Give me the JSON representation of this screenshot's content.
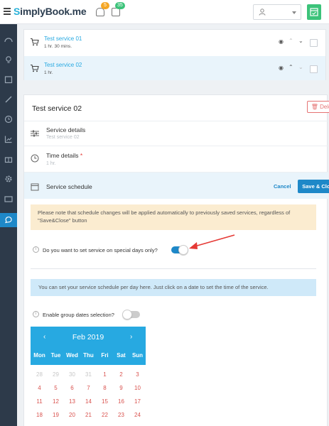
{
  "topbar": {
    "logo_prefix": "S",
    "logo_rest": "implyBook.me",
    "bell_badge": "5",
    "tasks_badge": "35",
    "badge_color_bell": "#f5a623",
    "badge_color_tasks": "#3cc37a"
  },
  "services": [
    {
      "name": "Test service 01",
      "duration": "1 hr. 30 mins."
    },
    {
      "name": "Test service 02",
      "duration": "1 hr."
    }
  ],
  "panel": {
    "title": "Test service 02",
    "delete_label": "Delete",
    "details_label": "Service details",
    "details_value": "Test service 02",
    "time_label": "Time details",
    "time_required": "*",
    "time_value": "1 hr.",
    "schedule_label": "Service schedule",
    "cancel_label": "Cancel",
    "save_label": "Save & Close",
    "warning_text": "Please note that schedule changes will be applied automatically to previously saved services, regardless of \"Save&Close\" button",
    "special_days_question": "Do you want to set service on special days only?",
    "special_days_on": true,
    "info_text": "You can set your service schedule per day here. Just click on a date to set the time of the service.",
    "group_dates_label": "Enable group dates selection?",
    "group_dates_on": false
  },
  "calendar": {
    "month": "Feb 2019",
    "prev": "‹",
    "next": "›",
    "weekdays": [
      "Mon",
      "Tue",
      "Wed",
      "Thu",
      "Fri",
      "Sat",
      "Sun"
    ],
    "weeks": [
      [
        {
          "d": "28",
          "m": true
        },
        {
          "d": "29",
          "m": true
        },
        {
          "d": "30",
          "m": true
        },
        {
          "d": "31",
          "m": true
        },
        {
          "d": "1"
        },
        {
          "d": "2"
        },
        {
          "d": "3"
        }
      ],
      [
        {
          "d": "4"
        },
        {
          "d": "5"
        },
        {
          "d": "6"
        },
        {
          "d": "7"
        },
        {
          "d": "8"
        },
        {
          "d": "9"
        },
        {
          "d": "10"
        }
      ],
      [
        {
          "d": "11"
        },
        {
          "d": "12"
        },
        {
          "d": "13"
        },
        {
          "d": "14"
        },
        {
          "d": "15"
        },
        {
          "d": "16"
        },
        {
          "d": "17"
        }
      ],
      [
        {
          "d": "18"
        },
        {
          "d": "19"
        },
        {
          "d": "20"
        },
        {
          "d": "21"
        },
        {
          "d": "22"
        },
        {
          "d": "23"
        },
        {
          "d": "24"
        }
      ]
    ],
    "header_color": "#27a9e1",
    "day_color": "#d9534f"
  },
  "colors": {
    "accent": "#1e88c8",
    "sidebar": "#2d3a4a",
    "annotation_arrow": "#e53935"
  }
}
